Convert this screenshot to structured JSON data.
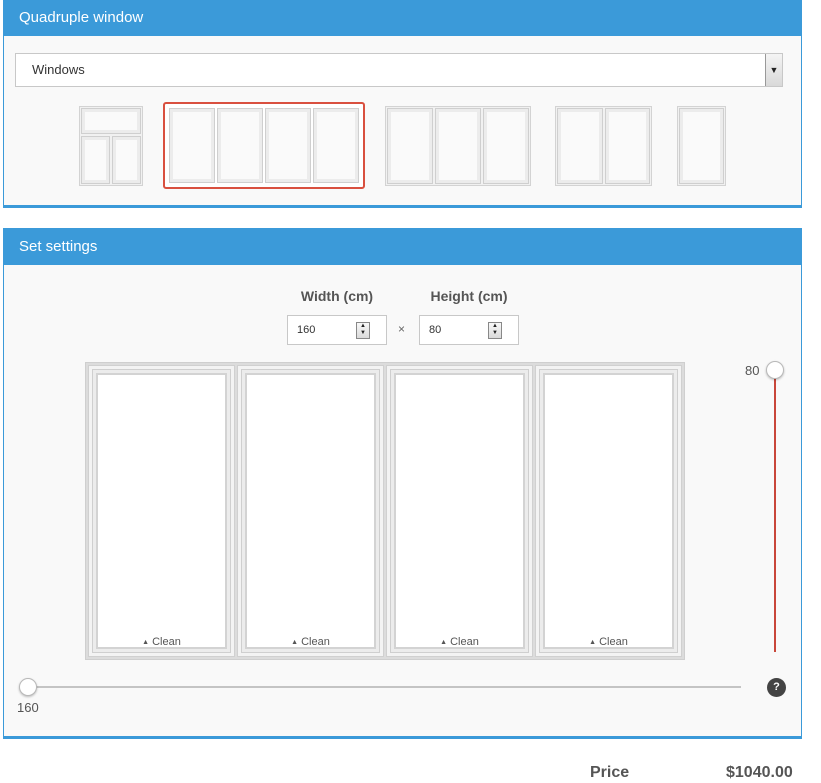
{
  "type_panel": {
    "title": "Quadruple window",
    "select_value": "Windows"
  },
  "settings_panel": {
    "title": "Set settings",
    "width_label": "Width (cm)",
    "height_label": "Height (cm)",
    "width_value": "160",
    "height_value": "80",
    "times_sign": "×",
    "sash_button_label": "Clean",
    "vertical_slider_value": "80",
    "horizontal_slider_value": "160",
    "help_label": "?"
  },
  "price": {
    "label": "Price",
    "value": "$1040.00"
  },
  "colors": {
    "accent": "#3b9ad9",
    "selected_border": "#d9503f",
    "slider_active": "#c9473a"
  }
}
